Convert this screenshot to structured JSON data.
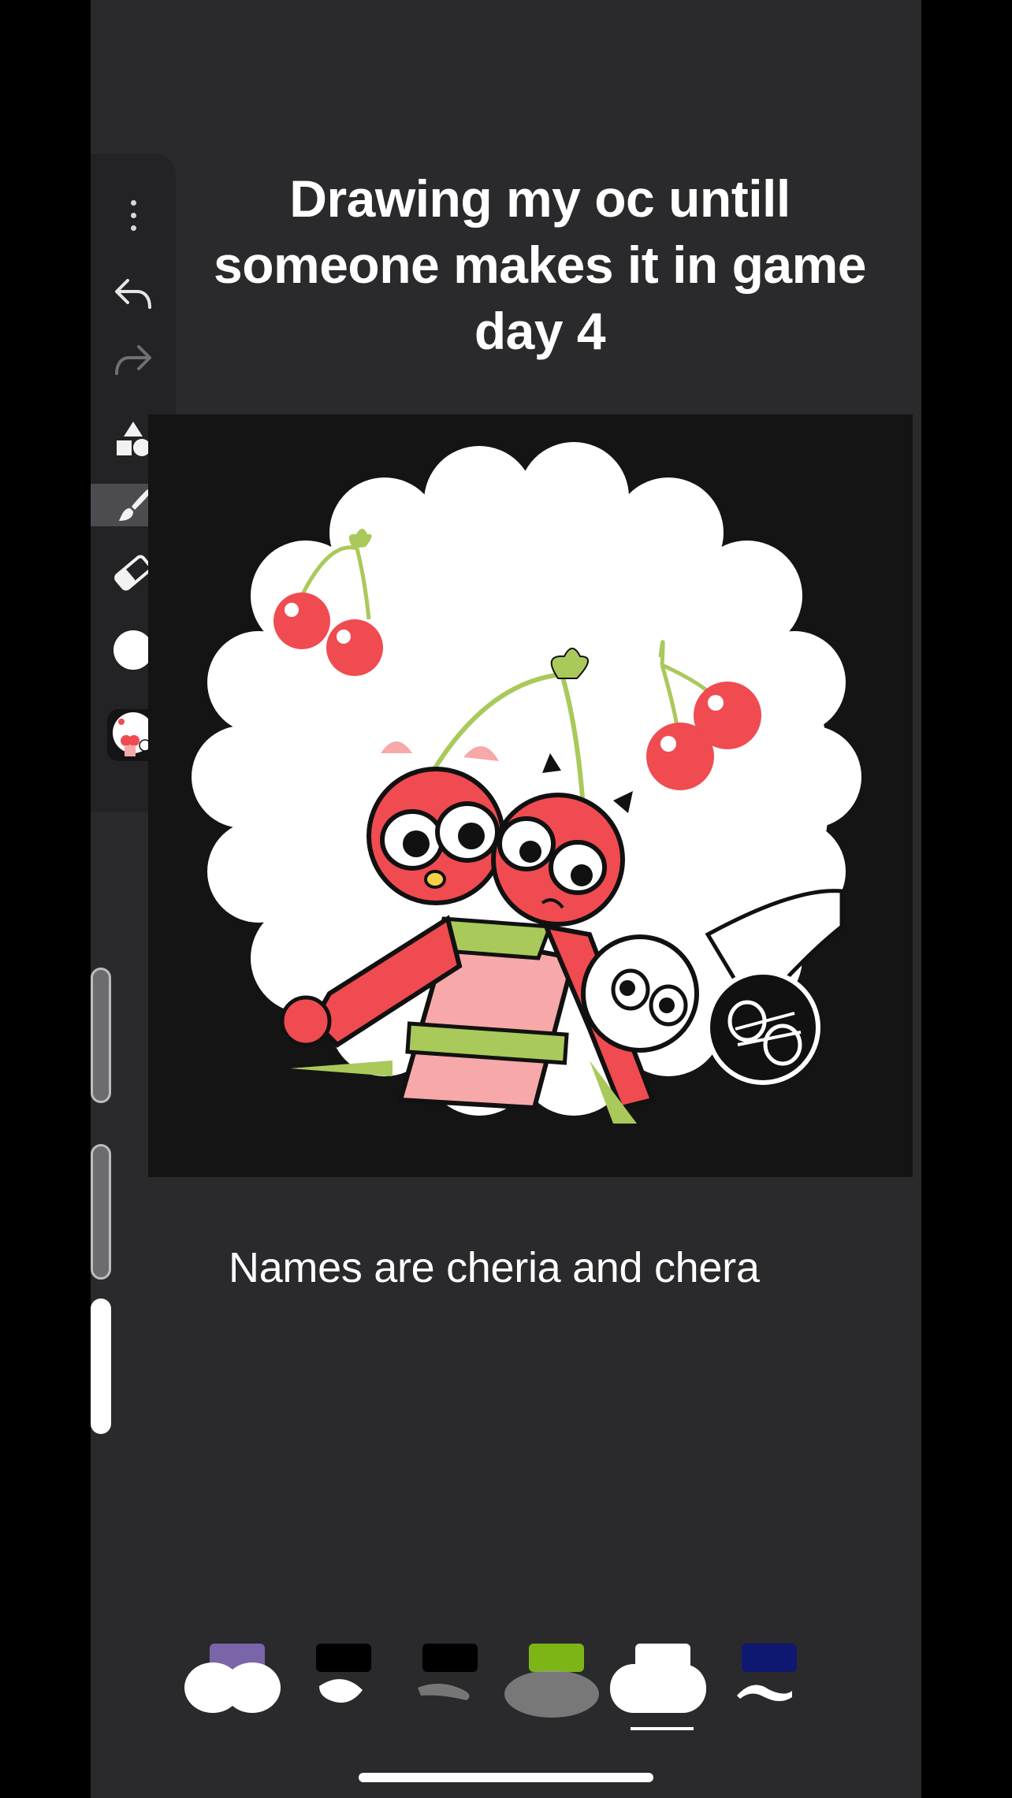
{
  "post": {
    "title_lines": [
      "Drawing my oc untill",
      "someone makes it in game",
      "day 4"
    ],
    "caption": "Names are cheria and chera"
  },
  "toolbar": {
    "tools": [
      {
        "name": "more",
        "icon": "more-vertical-icon"
      },
      {
        "name": "undo",
        "icon": "undo-icon"
      },
      {
        "name": "redo",
        "icon": "redo-icon",
        "enabled": false
      },
      {
        "name": "shapes",
        "icon": "shapes-icon"
      },
      {
        "name": "brush",
        "icon": "brush-icon",
        "selected": true
      },
      {
        "name": "eraser",
        "icon": "eraser-icon"
      },
      {
        "name": "color",
        "icon": "color-swatch-icon",
        "color": "#ffffff"
      },
      {
        "name": "layers",
        "icon": "layer-thumbnail"
      }
    ]
  },
  "brush_presets": [
    {
      "chip_color": "#7a65a8"
    },
    {
      "chip_color": "#000000"
    },
    {
      "chip_color": "#000000"
    },
    {
      "chip_color": "#7db516"
    },
    {
      "chip_color": "#ffffff",
      "selected": true
    },
    {
      "chip_color": "#0e1870"
    }
  ],
  "colors": {
    "background": "#2a2a2c",
    "toolbar": "#232325",
    "canvas": "#141414",
    "cherry_red": "#f04b50",
    "leaf_green": "#a9c95a",
    "pink": "#f7a8a8"
  }
}
